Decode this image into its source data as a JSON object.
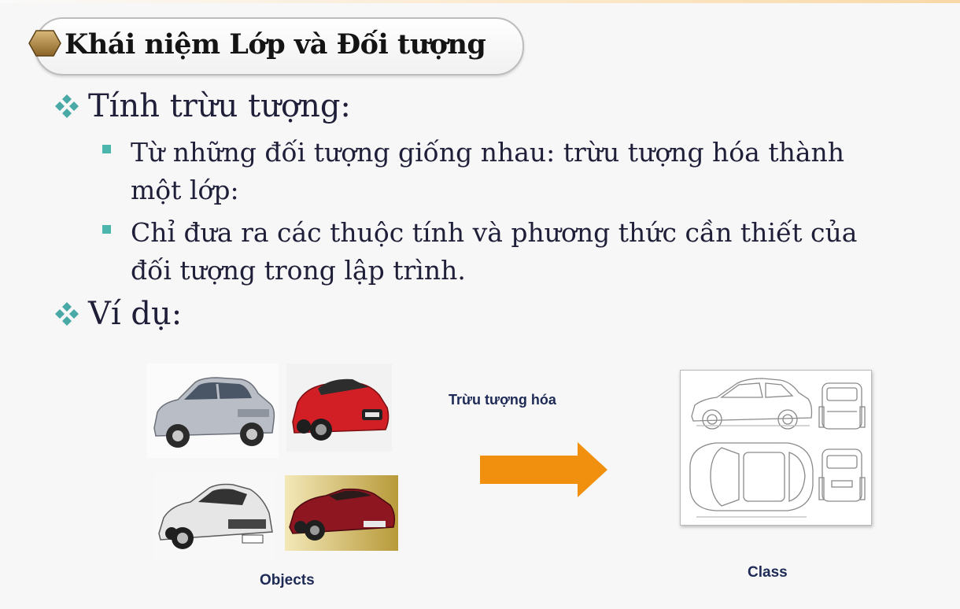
{
  "slide": {
    "title": "Khái niệm Lớp và Đối tượng",
    "bullets": [
      {
        "text": "Tính trừu tượng:",
        "sub": [
          {
            "line1": "Từ những đối tượng giống nhau: trừu tượng hóa thành",
            "line2": "một lớp:"
          },
          {
            "line1": "Chỉ đưa ra các thuộc tính và phương thức cần thiết của",
            "line2": "đối tượng trong lập trình."
          }
        ]
      },
      {
        "text": "Ví dụ:"
      }
    ]
  },
  "example": {
    "arrow_label": "Trừu tượng hóa",
    "objects_caption": "Objects",
    "class_caption": "Class",
    "cars": [
      {
        "name": "silver-sedan-photo",
        "color": "#b9bec6"
      },
      {
        "name": "red-sports-car-photo",
        "color": "#d21f26"
      },
      {
        "name": "white-sports-car-photo",
        "color": "#e6e6e6"
      },
      {
        "name": "dark-red-coupe-photo",
        "color": "#8e1621"
      }
    ]
  },
  "colors": {
    "arrow": "#f0900e",
    "bullet_square": "#4db6ac",
    "bullet_diamond": "#48a9a6",
    "title_hex": "#a27a3a"
  },
  "icons": [
    "hexagon-icon",
    "diamond-bullet-icon",
    "square-bullet-icon",
    "right-arrow-icon"
  ]
}
